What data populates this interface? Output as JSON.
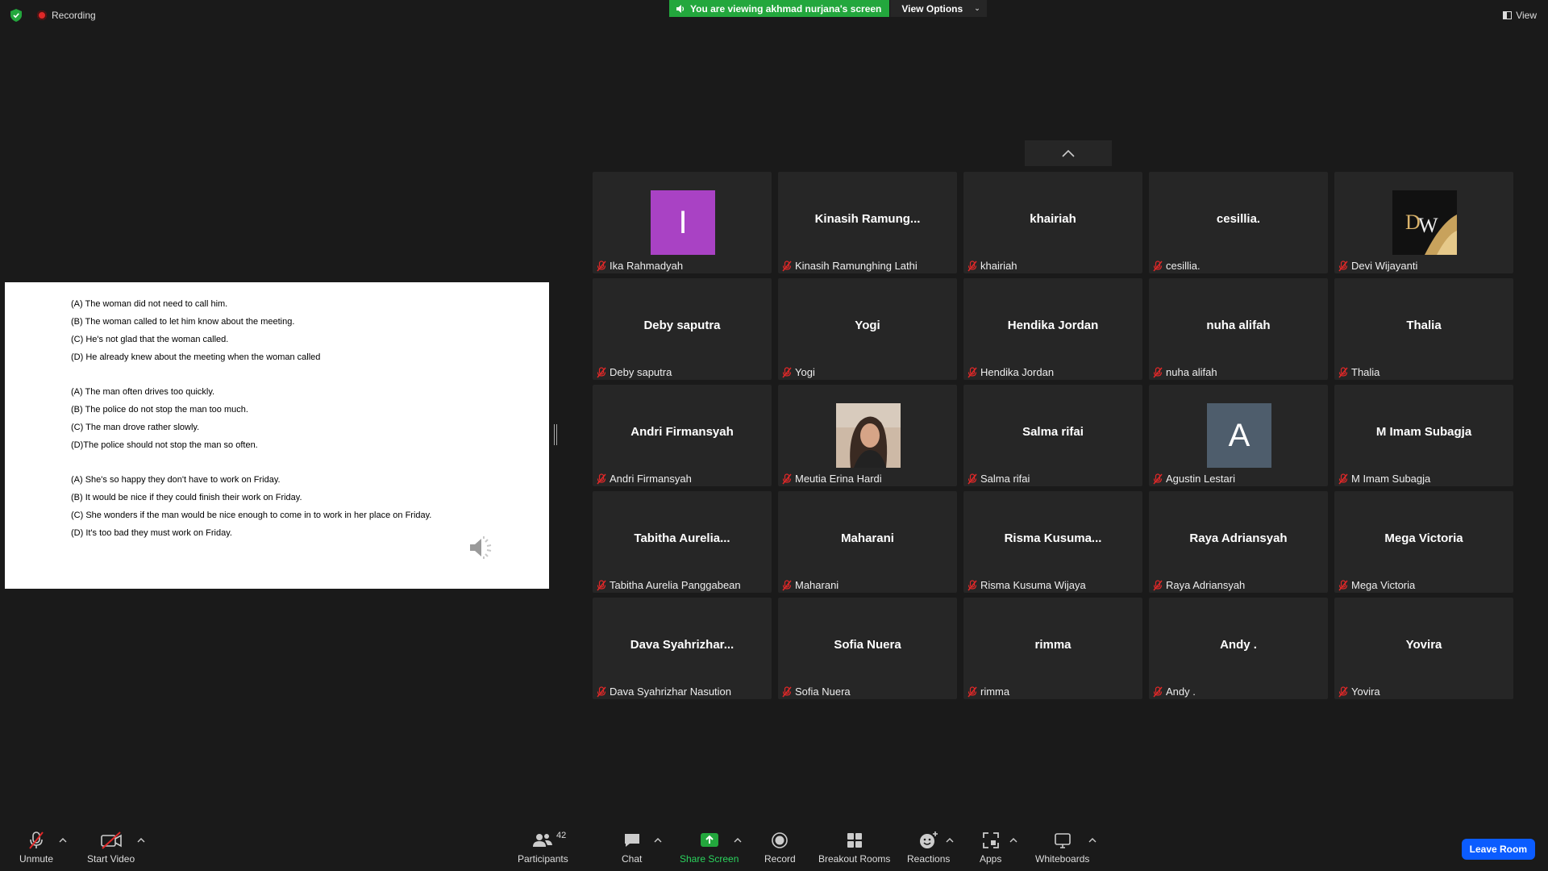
{
  "topbar": {
    "recording_label": "Recording",
    "banner_text": "You are viewing akhmad nurjana's screen",
    "view_options_label": "View Options",
    "view_label": "View"
  },
  "shared_screen": {
    "groups": [
      [
        "(A) The woman did not need to call him.",
        "(B) The woman called to let him know about the meeting.",
        "(C) He's not glad that the woman called.",
        "(D) He already knew about the meeting when the woman called"
      ],
      [
        "(A) The man often drives too quickly.",
        "(B) The police do not stop the man too much.",
        "(C) The man drove rather slowly.",
        "(D)The police should not stop the man so often."
      ],
      [
        "(A) She's so happy they don't have to work on Friday.",
        "(B) It would be nice if they could finish their work on Friday.",
        "(C) She wonders if the man would be nice enough to come in to work in her place on Friday.",
        "(D) It's too bad they must work on Friday."
      ]
    ]
  },
  "gallery": {
    "tiles": [
      {
        "name": "",
        "label": "Ika Rahmadyah",
        "avatar": "letter-i",
        "avatar_text": "I"
      },
      {
        "name": "Kinasih  Ramung...",
        "label": "Kinasih Ramunghing Lathi"
      },
      {
        "name": "khairiah",
        "label": "khairiah"
      },
      {
        "name": "cesillia.",
        "label": "cesillia."
      },
      {
        "name": "",
        "label": "Devi Wijayanti",
        "avatar": "logo",
        "avatar_text": "DW"
      },
      {
        "name": "Deby saputra",
        "label": "Deby saputra"
      },
      {
        "name": "Yogi",
        "label": "Yogi"
      },
      {
        "name": "Hendika Jordan",
        "label": "Hendika Jordan"
      },
      {
        "name": "nuha alifah",
        "label": "nuha alifah"
      },
      {
        "name": "Thalia",
        "label": "Thalia"
      },
      {
        "name": "Andri Firmansyah",
        "label": "Andri Firmansyah"
      },
      {
        "name": "",
        "label": "Meutia Erina Hardi",
        "avatar": "photo"
      },
      {
        "name": "Salma rifai",
        "label": "Salma rifai"
      },
      {
        "name": "",
        "label": "Agustin Lestari",
        "avatar": "letter-a",
        "avatar_text": "A"
      },
      {
        "name": "M Imam Subagja",
        "label": "M Imam Subagja"
      },
      {
        "name": "Tabitha  Aurelia...",
        "label": "Tabitha Aurelia Panggabean"
      },
      {
        "name": "Maharani",
        "label": "Maharani"
      },
      {
        "name": "Risma  Kusuma...",
        "label": "Risma Kusuma Wijaya"
      },
      {
        "name": "Raya Adriansyah",
        "label": "Raya Adriansyah"
      },
      {
        "name": "Mega Victoria",
        "label": "Mega Victoria"
      },
      {
        "name": "Dava  Syahrizhar...",
        "label": "Dava Syahrizhar Nasution"
      },
      {
        "name": "Sofia Nuera",
        "label": "Sofia Nuera"
      },
      {
        "name": "rimma",
        "label": "rimma"
      },
      {
        "name": "Andy .",
        "label": "Andy ."
      },
      {
        "name": "Yovira",
        "label": "Yovira"
      }
    ]
  },
  "toolbar": {
    "unmute": "Unmute",
    "start_video": "Start Video",
    "participants": "Participants",
    "participants_count": "42",
    "chat": "Chat",
    "share_screen": "Share Screen",
    "record": "Record",
    "breakout_rooms": "Breakout Rooms",
    "reactions": "Reactions",
    "apps": "Apps",
    "whiteboards": "Whiteboards",
    "leave_room": "Leave Room"
  },
  "colors": {
    "background": "#1a1a1a",
    "tile": "#262626",
    "banner_green": "#23a73d",
    "leave_blue": "#0b5cff",
    "mute_red": "#e02828"
  }
}
